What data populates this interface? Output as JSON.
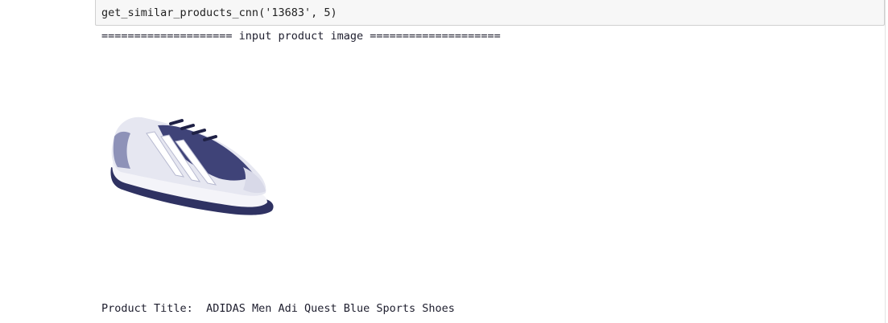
{
  "code_cell": {
    "code": "get_similar_products_cnn('13683', 5)"
  },
  "output": {
    "header": "==================== input product image ====================",
    "title_label": "Product Title:",
    "title_value": "ADIDAS Men Adi Quest Blue Sports Shoes"
  },
  "image": {
    "subject": "sports-shoe",
    "colors": {
      "primary": "#3f4378",
      "secondary": "#ecedf4",
      "accent": "#8e92b8"
    }
  }
}
